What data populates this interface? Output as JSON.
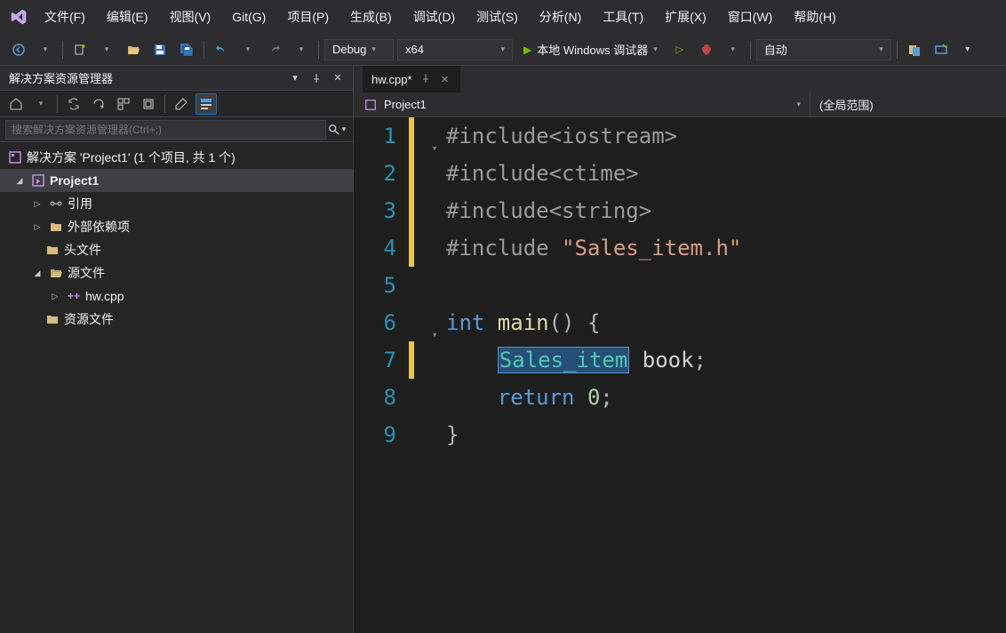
{
  "menu": {
    "items": [
      "文件(F)",
      "编辑(E)",
      "视图(V)",
      "Git(G)",
      "项目(P)",
      "生成(B)",
      "调试(D)",
      "测试(S)",
      "分析(N)",
      "工具(T)",
      "扩展(X)",
      "窗口(W)",
      "帮助(H)"
    ]
  },
  "toolbar": {
    "config": "Debug",
    "platform": "x64",
    "run_label": "本地 Windows 调试器",
    "auto": "自动"
  },
  "solution_explorer": {
    "title": "解决方案资源管理器",
    "search_placeholder": "搜索解决方案资源管理器(Ctrl+;)",
    "solution_label": "解决方案 'Project1' (1 个项目, 共 1 个)",
    "project": "Project1",
    "nodes": {
      "references": "引用",
      "external": "外部依赖项",
      "headers": "头文件",
      "sources": "源文件",
      "source_file": "hw.cpp",
      "resources": "资源文件"
    }
  },
  "editor": {
    "tab_label": "hw.cpp*",
    "nav_project": "Project1",
    "nav_scope": "(全局范围)",
    "line_numbers": [
      "1",
      "2",
      "3",
      "4",
      "5",
      "6",
      "7",
      "8",
      "9"
    ],
    "code": {
      "l1_pre": "#include",
      "l1_ang1": "<",
      "l1_h1": "iostream",
      "l1_ang2": ">",
      "l2_pre": "#include",
      "l2_ang1": "<",
      "l2_h1": "ctime",
      "l2_ang2": ">",
      "l3_pre": "#include",
      "l3_ang1": "<",
      "l3_h1": "string",
      "l3_ang2": ">",
      "l4_pre": "#include ",
      "l4_str": "\"Sales_item.h\"",
      "l6_kw": "int",
      "l6_fn": " main",
      "l6_pn": "() {",
      "l7_indent": "    ",
      "l7_type": "Sales_item",
      "l7_sp": " ",
      "l7_id": "book",
      "l7_sc": ";",
      "l8_indent": "    ",
      "l8_kw": "return",
      "l8_sp": " ",
      "l8_num": "0",
      "l8_sc": ";",
      "l9_brace": "}"
    }
  }
}
